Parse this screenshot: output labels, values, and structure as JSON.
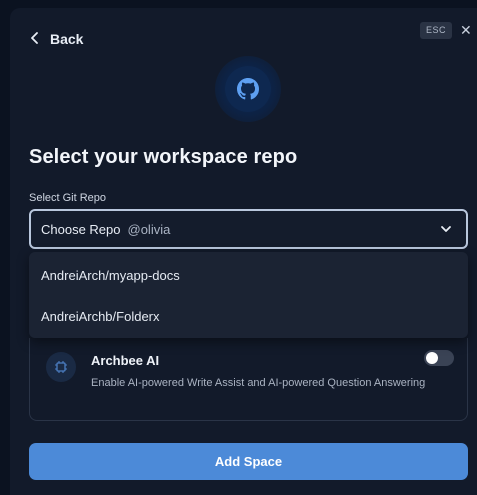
{
  "nav": {
    "back_label": "Back"
  },
  "esc_label": "ESC",
  "close_glyph": "✕",
  "logo_icon": "github-icon",
  "title": "Select your workspace repo",
  "field": {
    "label": "Select Git Repo",
    "selected_value": "Choose Repo",
    "user": "@olivia"
  },
  "dropdown": {
    "options": [
      "AndreiArch/myapp-docs",
      "AndreiArchb/Folderx"
    ]
  },
  "ai_card": {
    "title": "Archbee AI",
    "description": "Enable AI-powered Write Assist and AI-powered Question Answering",
    "toggle_on": false
  },
  "primary_button_label": "Add Space",
  "colors": {
    "background": "#121a2a",
    "accent": "#4c8ad8",
    "select_border": "#b9c7dd"
  }
}
